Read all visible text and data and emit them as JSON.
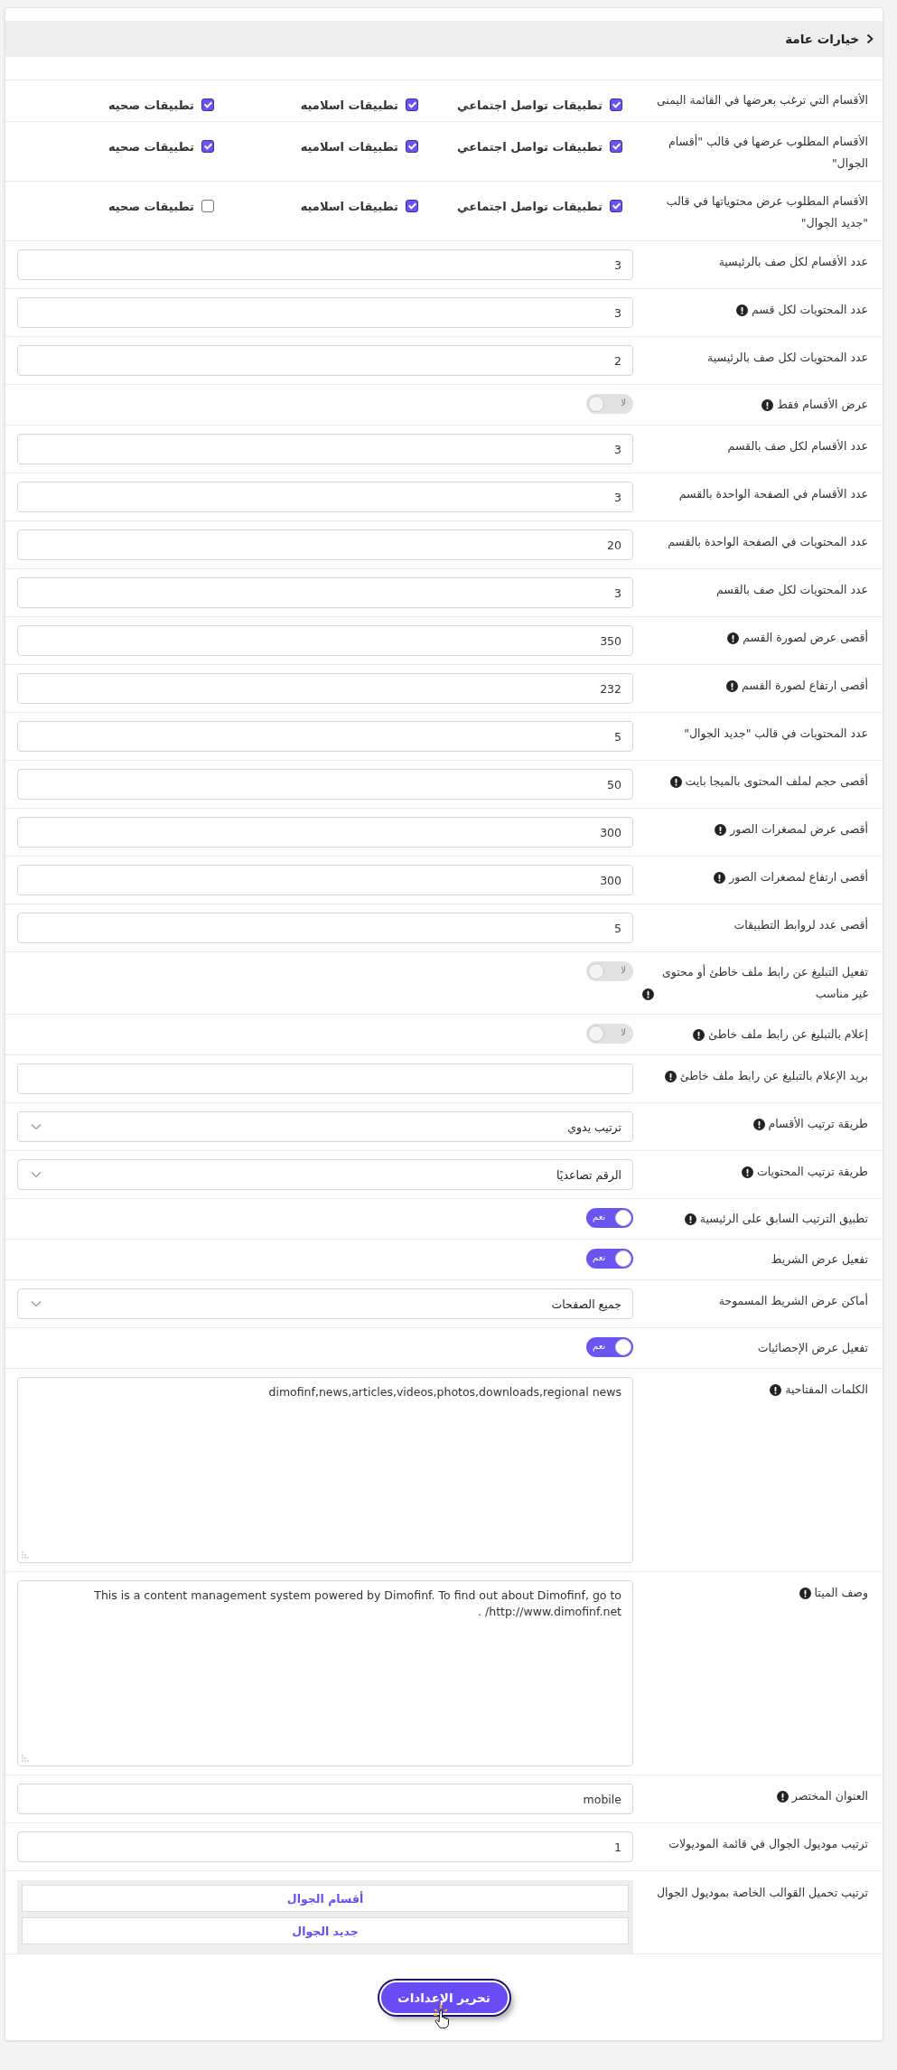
{
  "panel": {
    "title": "خيارات عامة"
  },
  "rows": [
    {
      "kind": "checkboxes",
      "label": "الأقسام التي ترغب بعرضها في القائمة اليمنى",
      "info": false,
      "options": [
        {
          "label": "تطبيقات تواصل اجتماعي",
          "checked": true
        },
        {
          "label": "تطبيقات اسلاميه",
          "checked": true
        },
        {
          "label": "تطبيقات صحيه",
          "checked": true
        }
      ]
    },
    {
      "kind": "checkboxes",
      "label": "الأقسام المطلوب عرضها في قالب \"أقسام الجوال\"",
      "info": false,
      "options": [
        {
          "label": "تطبيقات تواصل اجتماعي",
          "checked": true
        },
        {
          "label": "تطبيقات اسلاميه",
          "checked": true
        },
        {
          "label": "تطبيقات صحيه",
          "checked": true
        }
      ]
    },
    {
      "kind": "checkboxes",
      "label": "الأقسام المطلوب عرض محتوياتها في قالب \"جديد الجوال\"",
      "info": false,
      "options": [
        {
          "label": "تطبيقات تواصل اجتماعي",
          "checked": true
        },
        {
          "label": "تطبيقات اسلاميه",
          "checked": true
        },
        {
          "label": "تطبيقات صحيه",
          "checked": false
        }
      ]
    },
    {
      "kind": "input",
      "label": "عدد الأقسام لكل صف بالرئيسية",
      "info": false,
      "value": "3"
    },
    {
      "kind": "input",
      "label": "عدد المحتويات لكل قسم",
      "info": true,
      "value": "3"
    },
    {
      "kind": "input",
      "label": "عدد المحتويات لكل صف بالرئيسية",
      "info": false,
      "value": "2"
    },
    {
      "kind": "toggle",
      "label": "عرض الأقسام فقط",
      "info": true,
      "on": false,
      "toggle_text": "لا"
    },
    {
      "kind": "input",
      "label": "عدد الأقسام لكل صف بالقسم",
      "info": false,
      "value": "3"
    },
    {
      "kind": "input",
      "label": "عدد الأقسام في الصفحة الواحدة بالقسم",
      "info": false,
      "value": "3"
    },
    {
      "kind": "input",
      "label": "عدد المحتويات في الصفحة الواحدة بالقسم",
      "info": false,
      "value": "20"
    },
    {
      "kind": "input",
      "label": "عدد المحتويات لكل صف بالقسم",
      "info": false,
      "value": "3"
    },
    {
      "kind": "input",
      "label": "أقصى عرض لصورة القسم",
      "info": true,
      "value": "350"
    },
    {
      "kind": "input",
      "label": "أقصى ارتفاع لصورة القسم",
      "info": true,
      "value": "232"
    },
    {
      "kind": "input",
      "label": "عدد المحتويات في قالب \"جديد الجوال\"",
      "info": false,
      "value": "5"
    },
    {
      "kind": "input",
      "label": "أقصى حجم لملف المحتوى بالميجا بايت",
      "info": true,
      "value": "50"
    },
    {
      "kind": "input",
      "label": "أقصى عرض لمصغرات الصور",
      "info": true,
      "value": "300"
    },
    {
      "kind": "input",
      "label": "أقصى ارتفاع لمصغرات الصور",
      "info": true,
      "value": "300"
    },
    {
      "kind": "input",
      "label": "أقصى عدد لروابط التطبيقات",
      "info": false,
      "value": "5"
    },
    {
      "kind": "toggle",
      "label": "تفعيل التبليغ عن رابط ملف خاطئ أو محتوى غير مناسب",
      "info": true,
      "on": false,
      "toggle_text": "لا"
    },
    {
      "kind": "toggle",
      "label": "إعلام بالتبليغ عن رابط ملف خاطئ",
      "info": true,
      "on": false,
      "toggle_text": "لا"
    },
    {
      "kind": "input",
      "label": "بريد الإعلام بالتبليغ عن رابط ملف خاطئ",
      "info": true
    },
    {
      "kind": "select",
      "label": "طريقة ترتيب الأقسام",
      "info": true,
      "value": "ترتيب يدوي"
    },
    {
      "kind": "select",
      "label": "طريقة ترتيب المحتويات",
      "info": true,
      "value": "الرقم تصاعديًا"
    },
    {
      "kind": "toggle",
      "label": "تطبيق الترتيب السابق على الرئيسية",
      "info": true,
      "on": true,
      "toggle_text": "نعم"
    },
    {
      "kind": "toggle",
      "label": "تفعيل عرض الشريط",
      "info": false,
      "on": true,
      "toggle_text": "نعم"
    },
    {
      "kind": "select",
      "label": "أماكن عرض الشريط المسموحة",
      "info": false,
      "value": "جميع الصفحات"
    },
    {
      "kind": "toggle",
      "label": "تفعيل عرض الإحصائيات",
      "info": false,
      "on": true,
      "toggle_text": "نعم"
    },
    {
      "kind": "textarea",
      "label": "الكلمات المفتاحية",
      "info": true,
      "value": "dimofinf,news,articles,videos,photos,downloads,regional news"
    },
    {
      "kind": "textarea",
      "label": "وصف الميتا",
      "info": true,
      "value": "This is a content management system powered by Dimofinf. To find out about Dimofinf, go to http://www.dimofinf.net/ ."
    },
    {
      "kind": "input",
      "label": "العنوان المختصر",
      "info": true,
      "value": "mobile"
    },
    {
      "kind": "input",
      "label": "ترتيب موديول الجوال في قائمة الموديولات",
      "info": false,
      "value": "1"
    },
    {
      "kind": "sortlist",
      "label": "ترتيب تحميل القوالب الخاصة بموديول الجوال",
      "info": false,
      "items": [
        "أقسام الجوال",
        "جديد الجوال"
      ]
    }
  ],
  "submit": {
    "label": "تحرير الإعدادات"
  }
}
